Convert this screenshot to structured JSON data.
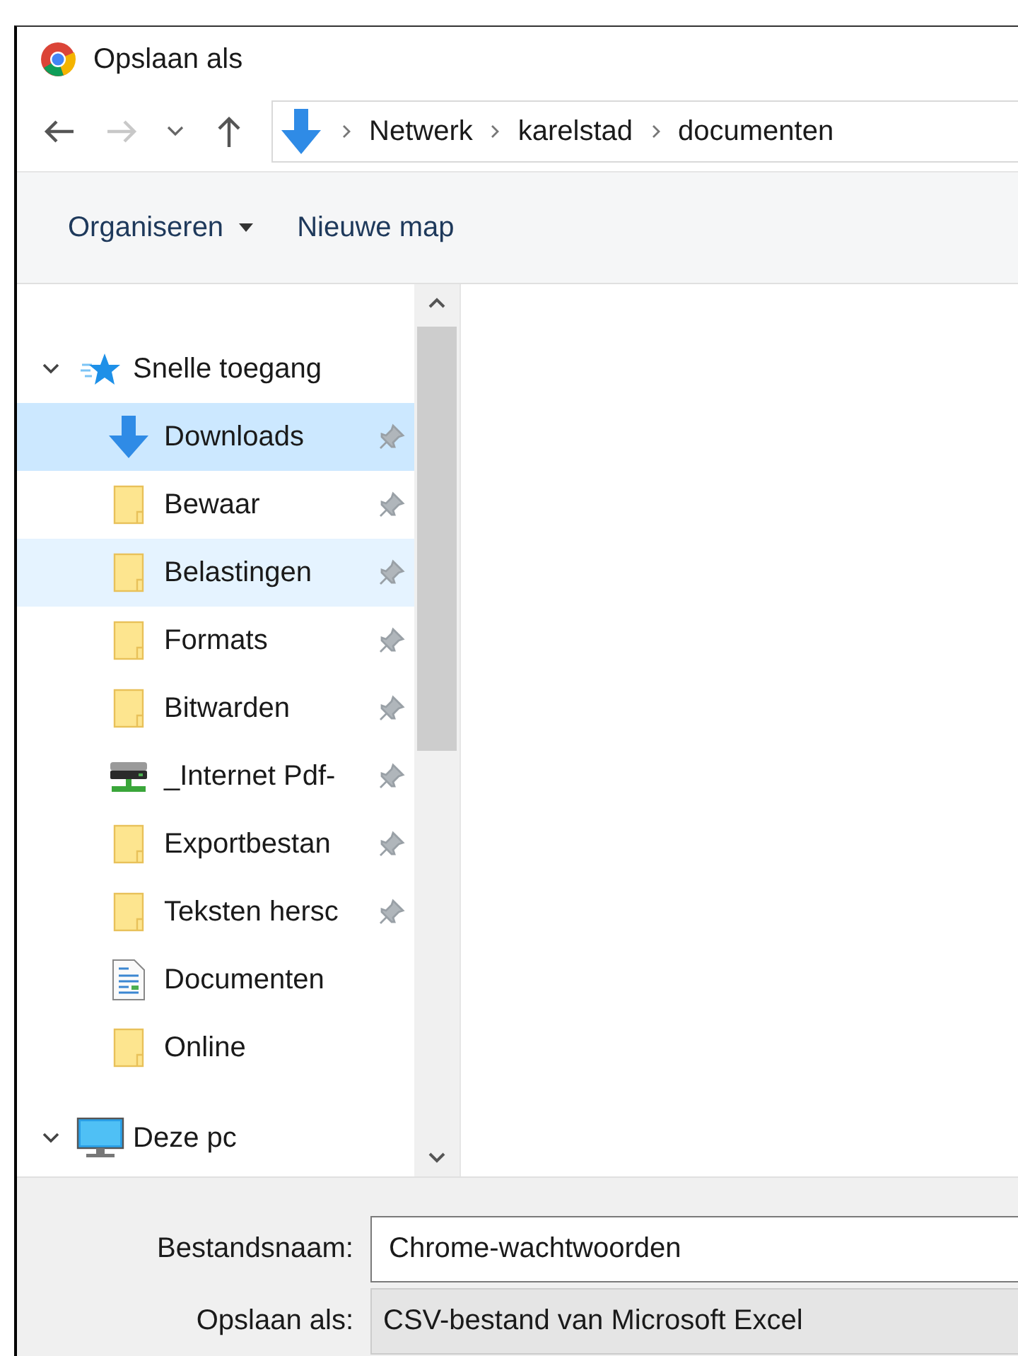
{
  "window": {
    "title": "Opslaan als"
  },
  "address_bar": {
    "path": [
      "Netwerk",
      "karelstad",
      "documenten"
    ]
  },
  "toolbar": {
    "buttons": [
      {
        "label": "Organiseren",
        "kind": "menu"
      },
      {
        "label": "Nieuwe map",
        "kind": "plain"
      }
    ]
  },
  "navigation_pane": {
    "items": [
      {
        "label": "Snelle toegang",
        "kind": "star",
        "expanded": true,
        "children": [
          {
            "label": "Downloads",
            "kind": "download",
            "pinned": true,
            "selected": true,
            "highlighted": false
          },
          {
            "label": "Bewaar",
            "kind": "folder",
            "pinned": true,
            "selected": false,
            "highlighted": false
          },
          {
            "label": "Belastingen",
            "kind": "folder",
            "pinned": true,
            "selected": false,
            "highlighted": true
          },
          {
            "label": "Formats",
            "kind": "folder",
            "pinned": true,
            "selected": false,
            "highlighted": false
          },
          {
            "label": "Bitwarden",
            "kind": "folder",
            "pinned": true,
            "selected": false,
            "highlighted": false
          },
          {
            "label": "_Internet Pdf-",
            "kind": "network-drive",
            "pinned": true,
            "selected": false,
            "highlighted": false
          },
          {
            "label": "Exportbestan",
            "kind": "folder",
            "pinned": true,
            "selected": false,
            "highlighted": false
          },
          {
            "label": "Teksten hersc",
            "kind": "folder",
            "pinned": true,
            "selected": false,
            "highlighted": false
          },
          {
            "label": "Documenten",
            "kind": "document",
            "pinned": false,
            "selected": false,
            "highlighted": false
          },
          {
            "label": "Online",
            "kind": "folder",
            "pinned": false,
            "selected": false,
            "highlighted": false
          }
        ]
      },
      {
        "label": "Deze pc",
        "kind": "computer",
        "expanded": true
      }
    ]
  },
  "file_name": {
    "label": "Bestandsnaam:",
    "value": "Chrome-wachtwoorden"
  },
  "save_as_type": {
    "label": "Opslaan als:",
    "value": "CSV-bestand van Microsoft Excel"
  }
}
